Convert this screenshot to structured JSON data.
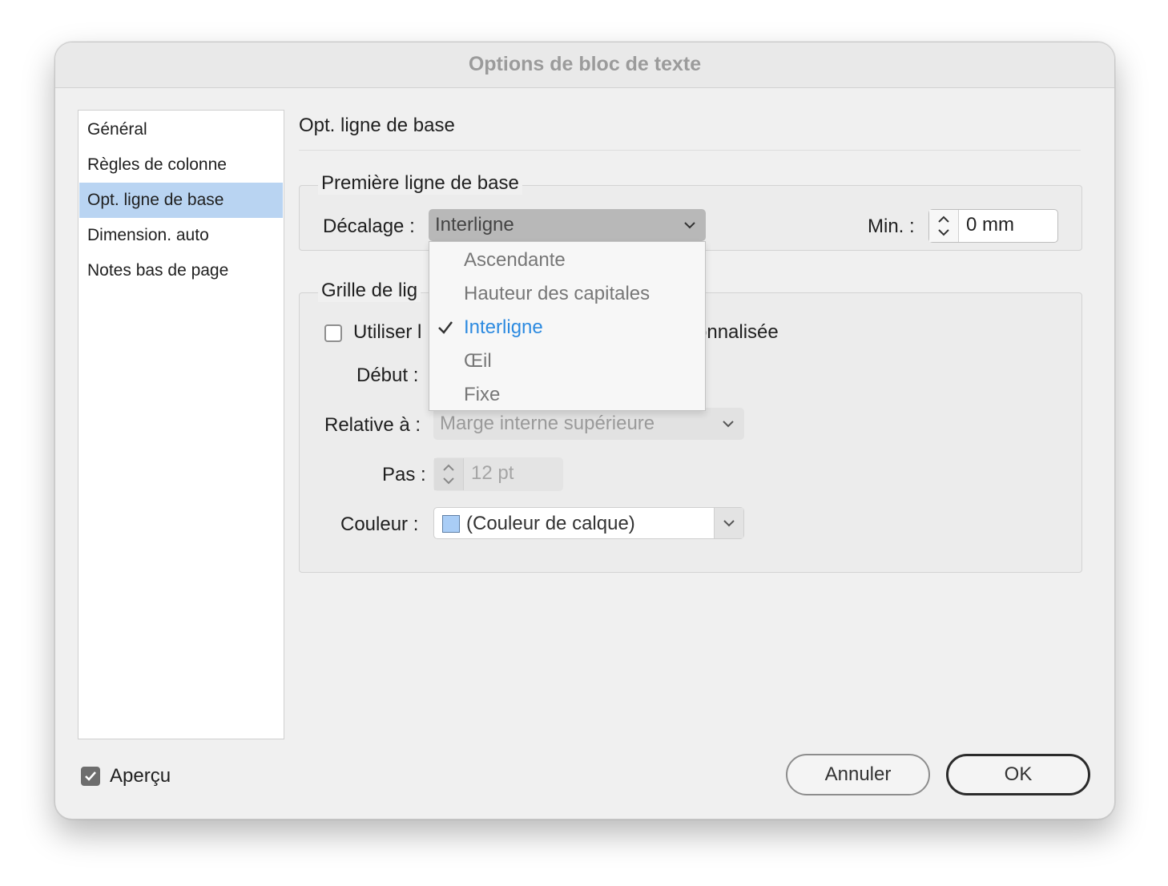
{
  "dialog": {
    "title": "Options de bloc de texte"
  },
  "sidebar": {
    "items": [
      {
        "label": "Général"
      },
      {
        "label": "Règles de colonne"
      },
      {
        "label": "Opt. ligne de base"
      },
      {
        "label": "Dimension. auto"
      },
      {
        "label": "Notes bas de page"
      }
    ],
    "selected": "Opt. ligne de base"
  },
  "main": {
    "section_title": "Opt. ligne de base",
    "first_baseline": {
      "legend": "Première ligne de base",
      "offset_label": "Décalage :",
      "offset_value": "Interligne",
      "min_label": "Min. :",
      "min_value": "0 mm"
    },
    "grid": {
      "legend": "Grille de lig",
      "use_custom_label_start": "Utiliser l",
      "use_custom_label_end": "onnalisée",
      "use_custom_checked": false,
      "start_label": "Début :",
      "relative_label": "Relative à :",
      "relative_value": "Marge interne supérieure",
      "step_label": "Pas :",
      "step_value": "12 pt",
      "color_label": "Couleur :",
      "color_value": "(Couleur de calque)",
      "color_swatch": "#a9cdf6"
    }
  },
  "menu": {
    "items": [
      {
        "label": "Ascendante"
      },
      {
        "label": "Hauteur des capitales"
      },
      {
        "label": "Interligne"
      },
      {
        "label": "Œil"
      },
      {
        "label": "Fixe"
      }
    ],
    "selected": "Interligne",
    "accent": "#2c8ae0"
  },
  "footer": {
    "preview_label": "Aperçu",
    "preview_checked": true,
    "cancel_label": "Annuler",
    "ok_label": "OK"
  }
}
